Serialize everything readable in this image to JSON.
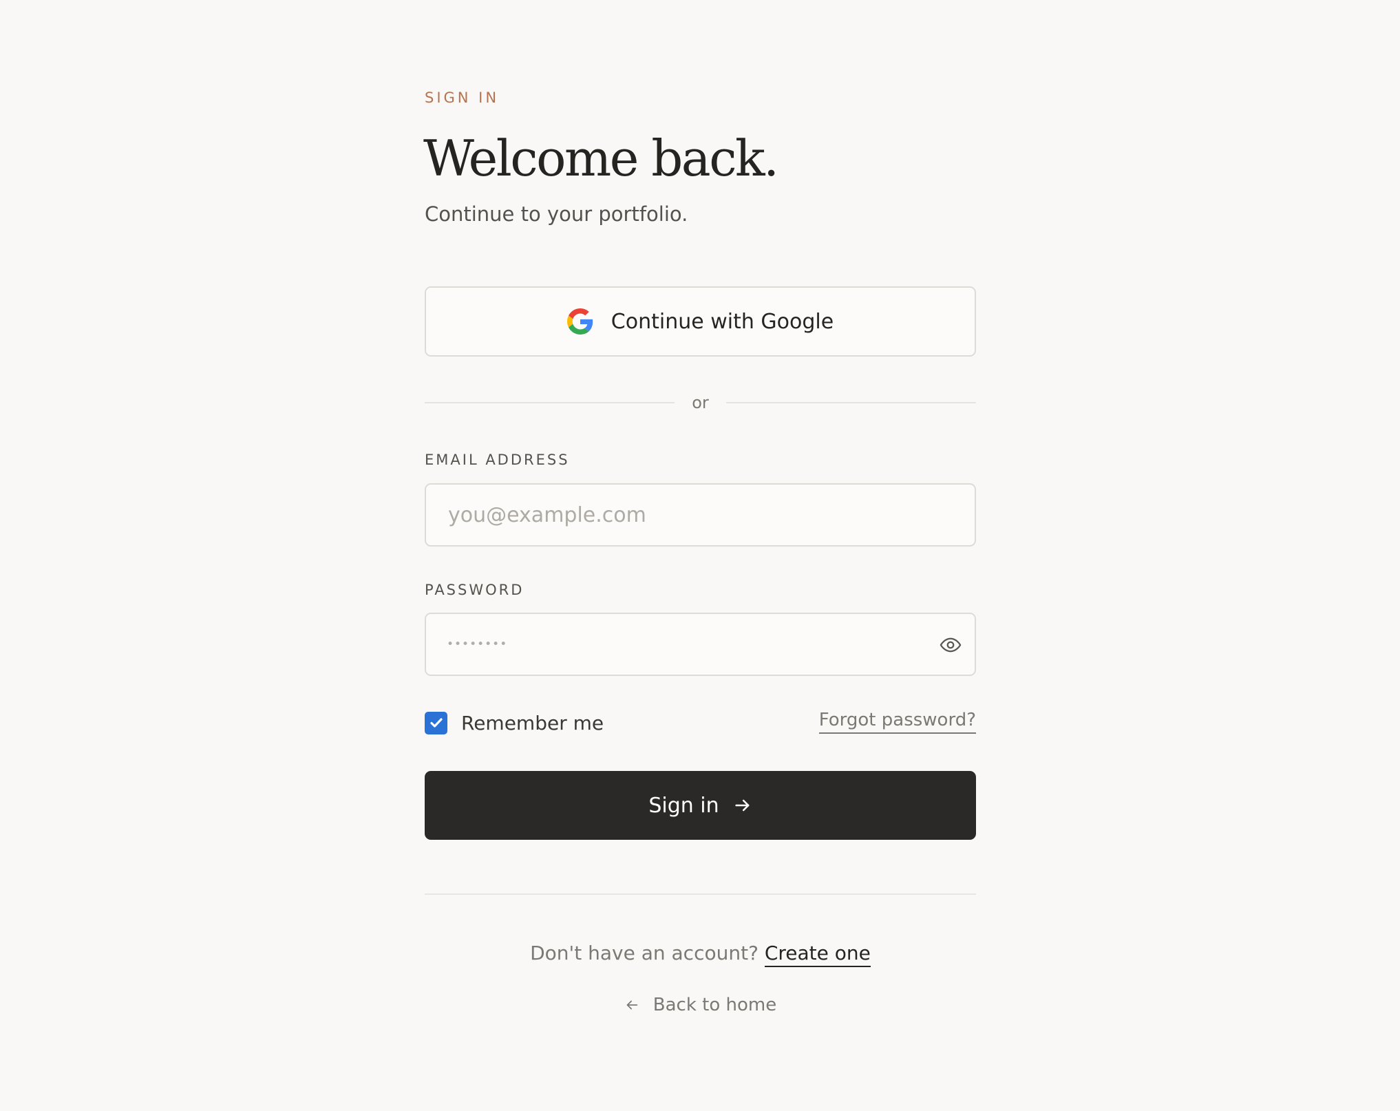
{
  "header": {
    "eyebrow": "SIGN IN",
    "title": "Welcome back.",
    "subtitle": "Continue to your portfolio."
  },
  "google": {
    "label": "Continue with Google",
    "icon": "google-logo-icon"
  },
  "divider": {
    "label": "or"
  },
  "email": {
    "label": "EMAIL ADDRESS",
    "placeholder": "you@example.com",
    "value": ""
  },
  "password": {
    "label": "PASSWORD",
    "masked_value": "••••••••",
    "toggle_icon": "eye-icon"
  },
  "remember": {
    "label": "Remember me",
    "checked": true
  },
  "forgot": {
    "label": "Forgot password?"
  },
  "submit": {
    "label": "Sign in",
    "icon": "arrow-right-icon"
  },
  "footer": {
    "prompt": "Don't have an account?",
    "create_label": "Create one",
    "back_label": "Back to home",
    "back_icon": "arrow-left-icon"
  },
  "colors": {
    "background": "#f9f8f6",
    "accent": "#b5734f",
    "primary_button": "#2a2927",
    "checkbox": "#2b72d6"
  }
}
